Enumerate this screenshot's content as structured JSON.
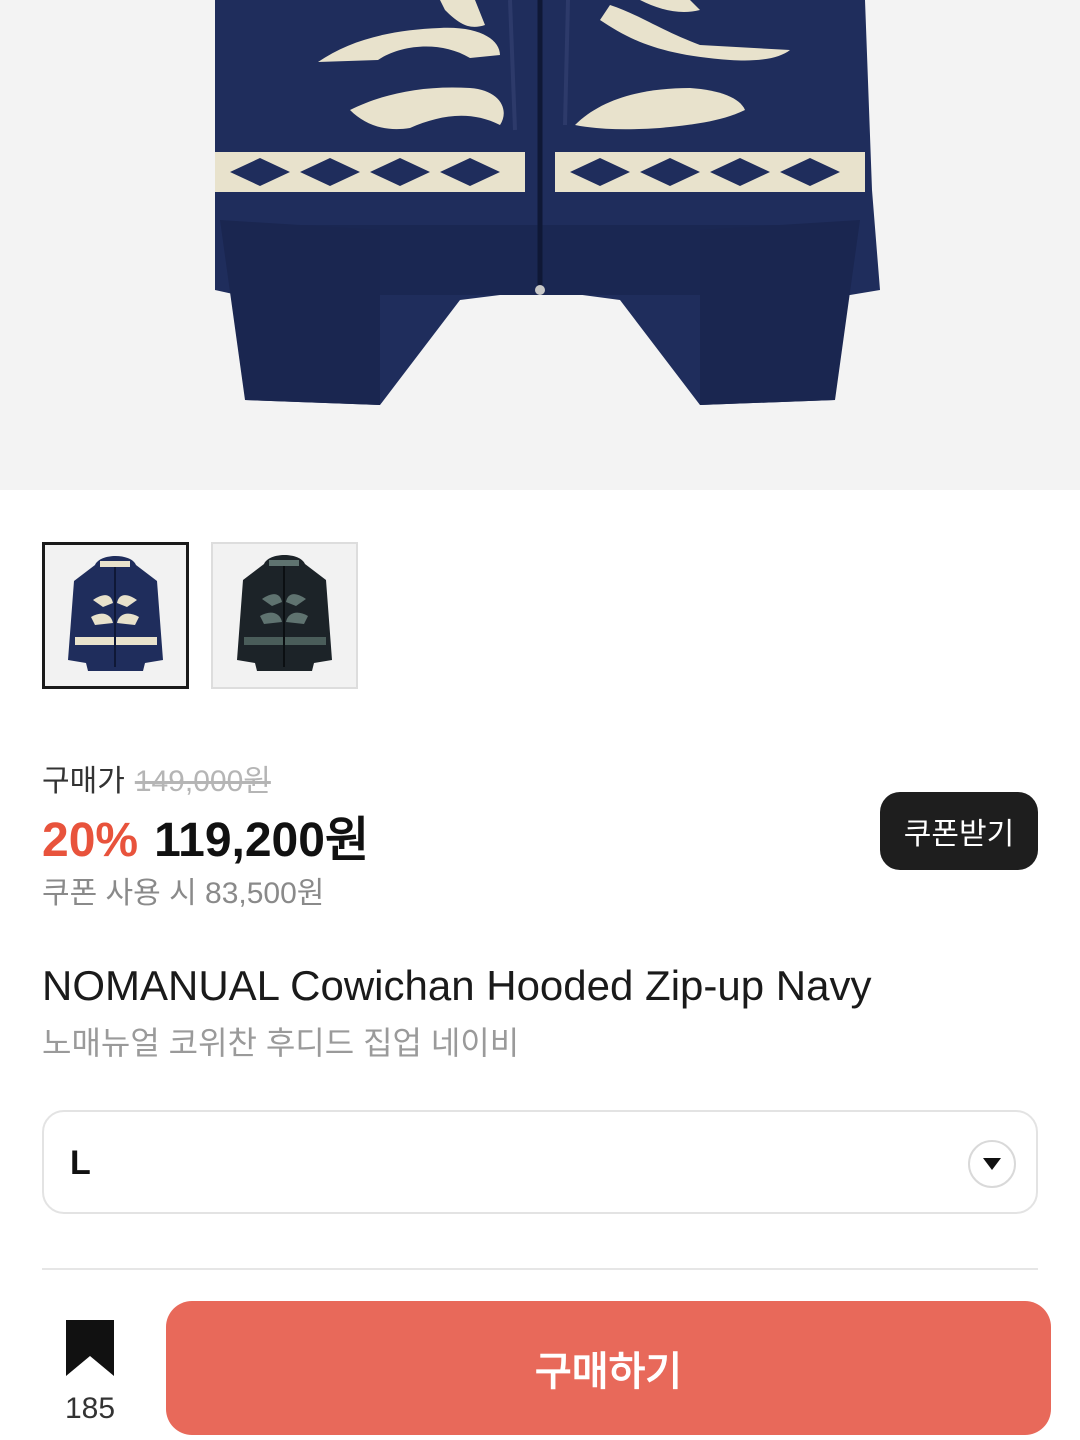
{
  "product": {
    "name_en": "NOMANUAL Cowichan Hooded Zip-up Navy",
    "name_ko": "노매뉴얼 코위찬 후디드 집업 네이비",
    "thumbnails": [
      {
        "color_name": "navy",
        "color": "#1f2d5c",
        "selected": true
      },
      {
        "color_name": "black",
        "color": "#1c2328",
        "selected": false
      }
    ]
  },
  "price": {
    "label": "구매가",
    "original": "149,000원",
    "discount": "20%",
    "sale": "119,200원",
    "coupon_price": "쿠폰 사용 시 83,500원",
    "discount_color": "#e8533c"
  },
  "coupon_button": {
    "label": "쿠폰받기"
  },
  "size_select": {
    "value": "L",
    "icon": "chevron-down-icon"
  },
  "bottom_bar": {
    "bookmark_icon": "bookmark-icon",
    "bookmark_count": "185",
    "buy_label": "구매하기",
    "buy_color": "#e8695a"
  }
}
